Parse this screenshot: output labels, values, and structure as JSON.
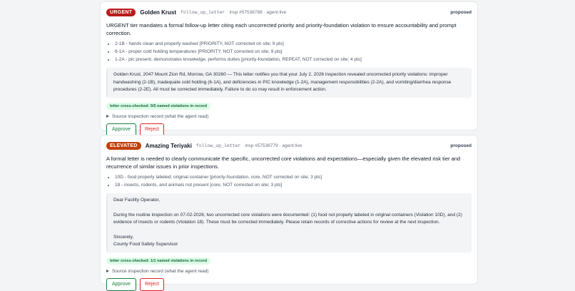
{
  "cards": [
    {
      "tier": "URGENT",
      "establishment": "Golden Krust",
      "kind": "follow_up_letter",
      "meta": "insp #57538788 · agent:live",
      "status": "proposed",
      "summary": "URGENT tier mandates a formal follow-up letter citing each uncorrected priority and priority-foundation violation to ensure accountability and prompt correction.",
      "violations": [
        "2-1B - hands clean and properly washed [PRIORITY, NOT corrected on site; 9 pts]",
        "6-1A - proper cold holding temperatures [PRIORITY, NOT corrected on site; 9 pts]",
        "1-2A - pic present, demonstrates knowledge, performs duties [priority-foundation, REPEAT, NOT corrected on site; 4 pts]"
      ],
      "letter": [
        "Golden Krust, 2047 Mount Zion Rd, Morrow, GA 30260 — This letter notifies you that your July 2, 2026 inspection revealed uncorrected priority violations: improper handwashing (2-1B), inadequate cold holding (6-1A), and deficiencies in PIC knowledge (1-2A), management responsibilities (2-2A), and vomiting/diarrhea response procedures (2-2E). All must be corrected immediately. Failure to do so may result in enforcement action."
      ],
      "check": "letter cross-checked: 5/5 named violations in record",
      "source_label": "Source inspection record (what the agent read)",
      "approve_label": "Approve",
      "reject_label": "Reject"
    },
    {
      "tier": "ELEVATED",
      "establishment": "Amazing Teriyaki",
      "kind": "follow_up_letter",
      "meta": "insp #57538779 · agent:live",
      "status": "proposed",
      "summary": "A formal letter is needed to clearly communicate the specific, uncorrected core violations and expectations—especially given the elevated risk tier and recurrence of similar issues in prior inspections.",
      "violations": [
        "10D - food properly labeled; original container [priority-foundation, core, NOT corrected on site; 3 pts]",
        "18 - insects, rodents, and animals not present [core, NOT corrected on site; 3 pts]"
      ],
      "letter": [
        "Dear Facility Operator,",
        "During the routine inspection on 07-02-2026, two uncorrected core violations were documented: (1) food not properly labeled in original containers (Violation 10D), and (2) evidence of insects or rodents (Violation 18). These must be corrected immediately. Please retain records of corrective actions for review at the next inspection.",
        "Sincerely,\nCounty Food Safety Supervisor"
      ],
      "check": "letter cross-checked: 1/1 named violations in record",
      "source_label": "Source inspection record (what the agent read)",
      "approve_label": "Approve",
      "reject_label": "Reject"
    }
  ]
}
